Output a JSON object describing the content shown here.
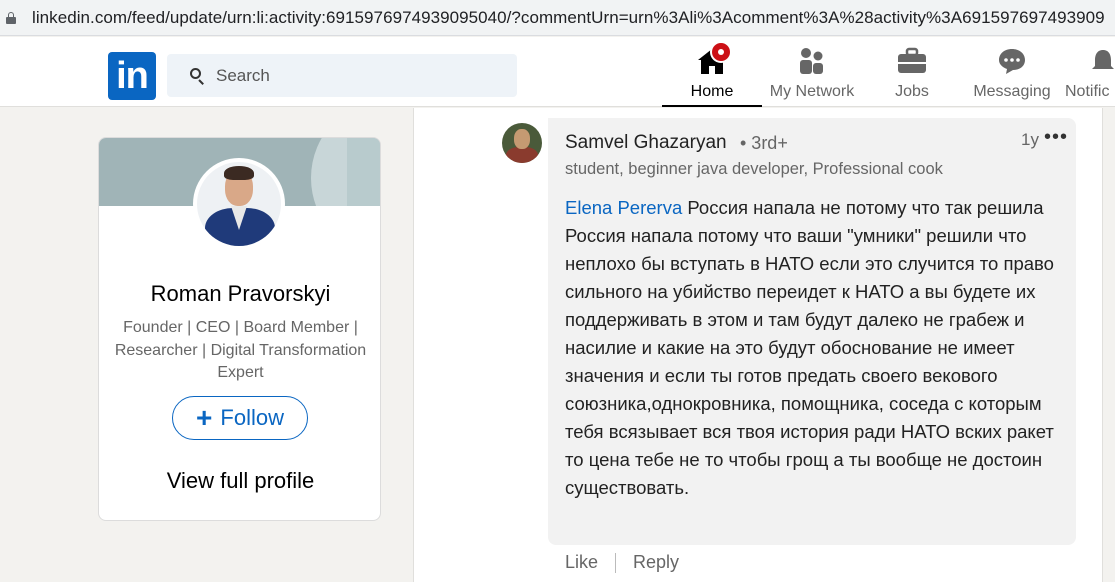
{
  "browser": {
    "url": "linkedin.com/feed/update/urn:li:activity:6915976974939095040/?commentUrn=urn%3Ali%3Acomment%3A%28activity%3A691597697493909"
  },
  "header": {
    "logo_text": "in",
    "search_placeholder": "Search",
    "nav": {
      "home": "Home",
      "network": "My Network",
      "jobs": "Jobs",
      "messaging": "Messaging",
      "notifications": "Notific"
    }
  },
  "profile_card": {
    "name": "Roman Pravorskyi",
    "headline": "Founder | CEO | Board Member | Researcher | Digital Transformation Expert",
    "follow_label": "Follow",
    "view_profile_label": "View full profile"
  },
  "comment": {
    "author": "Samvel Ghazaryan",
    "degree": "• 3rd+",
    "time": "1y",
    "more": "•••",
    "author_headline": "student, beginner java developer, Professional cook",
    "mention": "Elena Pererva",
    "text": " Россия напала не потому что так решила Россия напала потому что ваши \"умники\" решили что неплохо бы вступать в НАТО если это случится то право сильного на убийство переидет к НАТО а вы будете их поддерживать в этом и там будут далеко не грабеж и насилие и какие на это будут обоснование не имеет значения и если ты готов предать своего векового союзника,однокровника, помощника, соседа с которым тебя всязывает вся твоя история ради НАТО вских ракет то цена тебе не то чтобы грощ а ты вообще не достоин существовать.",
    "like_label": "Like",
    "reply_label": "Reply"
  },
  "colors": {
    "brand": "#0a66c2",
    "notification_badge": "#cc1016"
  }
}
